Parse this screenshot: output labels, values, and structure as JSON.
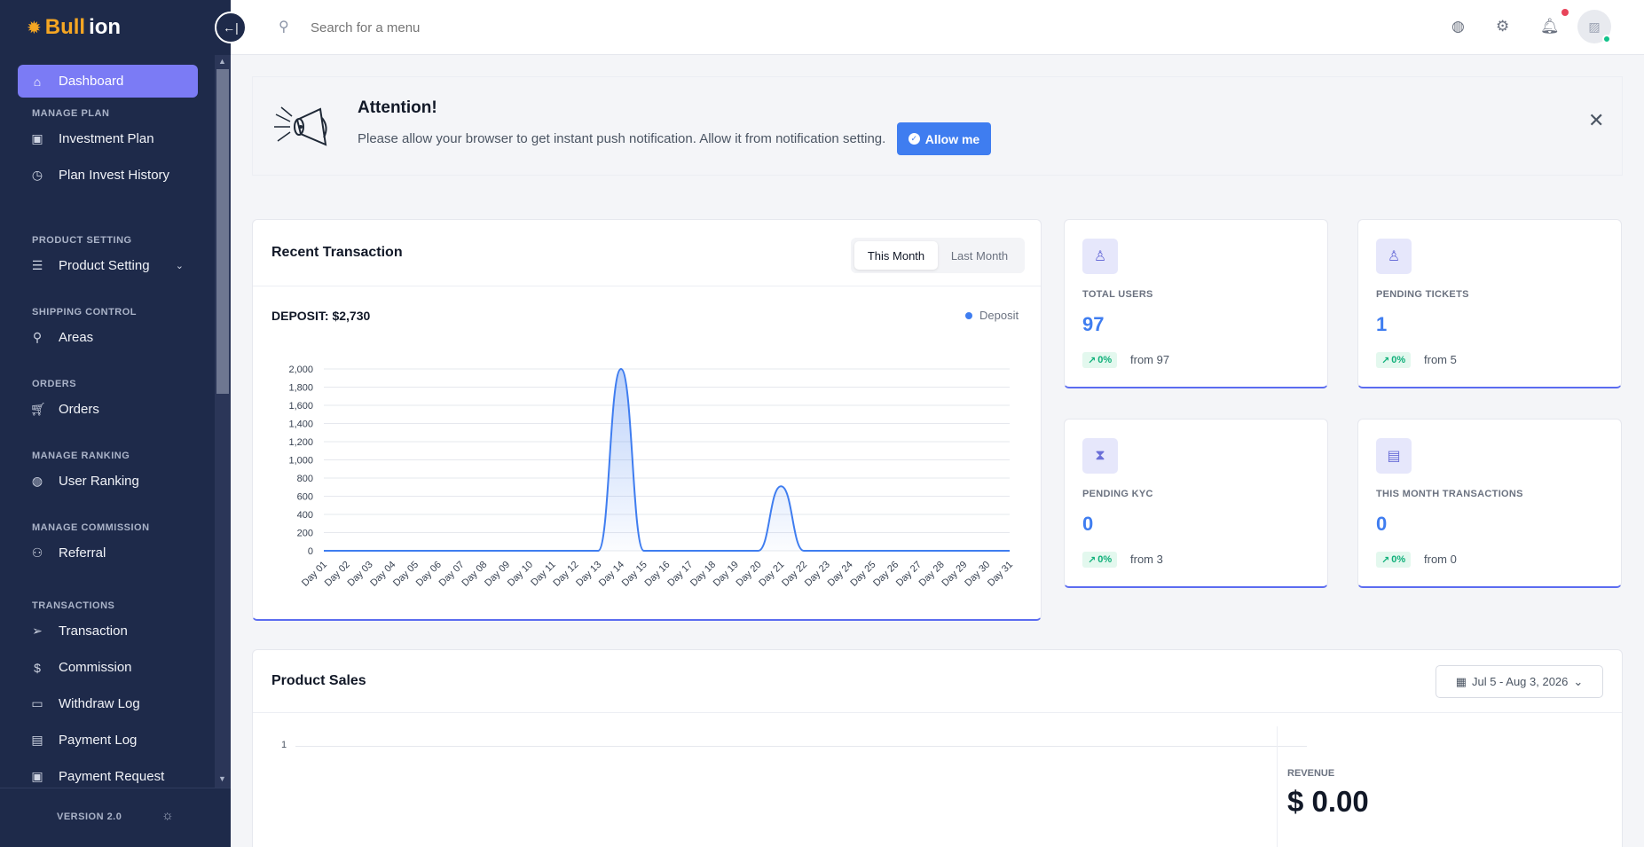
{
  "brand": {
    "prefix": "Bull",
    "suffix": "ion"
  },
  "sidebar": {
    "dashboard": "Dashboard",
    "sections": {
      "manage_plan": "MANAGE PLAN",
      "product_setting": "PRODUCT SETTING",
      "shipping_control": "SHIPPING CONTROL",
      "orders": "ORDERS",
      "manage_ranking": "MANAGE RANKING",
      "manage_commission": "MANAGE COMMISSION",
      "transactions": "TRANSACTIONS"
    },
    "items": {
      "investment_plan": "Investment Plan",
      "plan_invest_history": "Plan Invest History",
      "product_setting": "Product Setting",
      "areas": "Areas",
      "orders": "Orders",
      "user_ranking": "User Ranking",
      "referral": "Referral",
      "transaction": "Transaction",
      "commission": "Commission",
      "withdraw_log": "Withdraw Log",
      "payment_log": "Payment Log",
      "payment_request": "Payment Request"
    },
    "version": "VERSION 2.0"
  },
  "header": {
    "search_placeholder": "Search for a menu"
  },
  "alert": {
    "title": "Attention!",
    "text": "Please allow your browser to get instant push notification. Allow it from notification setting.",
    "button": "Allow me"
  },
  "recent_transaction": {
    "title": "Recent Transaction",
    "tab_active": "This Month",
    "tab_inactive": "Last Month",
    "deposit_label": "DEPOSIT: $2,730",
    "legend": "Deposit"
  },
  "stats": [
    {
      "label": "TOTAL USERS",
      "value": "97",
      "change": "0%",
      "from": "from 97"
    },
    {
      "label": "PENDING TICKETS",
      "value": "1",
      "change": "0%",
      "from": "from 5"
    },
    {
      "label": "PENDING KYC",
      "value": "0",
      "change": "0%",
      "from": "from 3"
    },
    {
      "label": "THIS MONTH TRANSACTIONS",
      "value": "0",
      "change": "0%",
      "from": "from 0"
    }
  ],
  "product_sales": {
    "title": "Product Sales",
    "date_range": "Jul 5 - Aug 3, 2026",
    "y_tick": "1",
    "revenue_label": "REVENUE",
    "revenue_value": "$ 0.00"
  },
  "colors": {
    "accent": "#3f7df0",
    "sidebar": "#1e2a4a",
    "active": "#7b7bf5"
  },
  "chart_data": {
    "type": "area",
    "series": [
      {
        "name": "Deposit",
        "values": [
          0,
          0,
          0,
          0,
          0,
          0,
          0,
          0,
          0,
          0,
          0,
          0,
          0,
          2000,
          0,
          0,
          0,
          0,
          0,
          0,
          710,
          0,
          0,
          0,
          0,
          0,
          0,
          0,
          0,
          0,
          0
        ]
      }
    ],
    "categories": [
      "Day 01",
      "Day 02",
      "Day 03",
      "Day 04",
      "Day 05",
      "Day 06",
      "Day 07",
      "Day 08",
      "Day 09",
      "Day 10",
      "Day 11",
      "Day 12",
      "Day 13",
      "Day 14",
      "Day 15",
      "Day 16",
      "Day 17",
      "Day 18",
      "Day 19",
      "Day 20",
      "Day 21",
      "Day 22",
      "Day 23",
      "Day 24",
      "Day 25",
      "Day 26",
      "Day 27",
      "Day 28",
      "Day 29",
      "Day 30",
      "Day 31"
    ],
    "y_ticks": [
      "0",
      "200",
      "400",
      "600",
      "800",
      "1,000",
      "1,200",
      "1,400",
      "1,600",
      "1,800",
      "2,000"
    ],
    "ylim": [
      0,
      2000
    ],
    "grid": true,
    "legend": "top-right"
  }
}
